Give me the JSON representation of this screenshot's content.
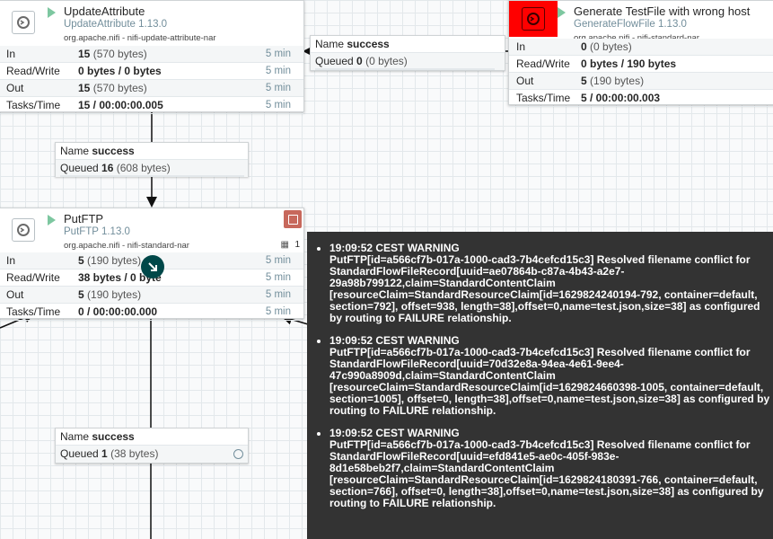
{
  "processors": {
    "update": {
      "name": "UpdateAttribute",
      "type": "UpdateAttribute 1.13.0",
      "bundle": "org.apache.nifi - nifi-update-attribute-nar",
      "stats": [
        {
          "label": "In",
          "value": "15",
          "detail": "(570 bytes)",
          "time": "5 min"
        },
        {
          "label": "Read/Write",
          "value": "0 bytes / 0 bytes",
          "detail": "",
          "time": "5 min"
        },
        {
          "label": "Out",
          "value": "15",
          "detail": "(570 bytes)",
          "time": "5 min"
        },
        {
          "label": "Tasks/Time",
          "value": "15 / 00:00:00.005",
          "detail": "",
          "time": "5 min"
        }
      ]
    },
    "generate": {
      "name": "Generate TestFile with wrong host",
      "type": "GenerateFlowFile 1.13.0",
      "bundle": "org.apache.nifi - nifi-standard-nar",
      "stats": [
        {
          "label": "In",
          "value": "0",
          "detail": "(0 bytes)",
          "time": ""
        },
        {
          "label": "Read/Write",
          "value": "0 bytes / 190 bytes",
          "detail": "",
          "time": ""
        },
        {
          "label": "Out",
          "value": "5",
          "detail": "(190 bytes)",
          "time": ""
        },
        {
          "label": "Tasks/Time",
          "value": "5 / 00:00:00.003",
          "detail": "",
          "time": ""
        }
      ]
    },
    "putftp": {
      "name": "PutFTP",
      "type": "PutFTP 1.13.0",
      "bundle": "org.apache.nifi - nifi-standard-nar",
      "task_count": "1",
      "stats": [
        {
          "label": "In",
          "value": "5",
          "detail": "(190 bytes)",
          "time": "5 min"
        },
        {
          "label": "Read/Write",
          "value": "38 bytes / 0 byte",
          "detail": "",
          "time": "5 min"
        },
        {
          "label": "Out",
          "value": "5",
          "detail": "(190 bytes)",
          "time": "5 min"
        },
        {
          "label": "Tasks/Time",
          "value": "0 / 00:00:00.000",
          "detail": "",
          "time": "5 min"
        }
      ]
    }
  },
  "connections": {
    "top": {
      "name_label": "Name",
      "name": "success",
      "queued_label": "Queued",
      "count": "0",
      "size": "(0 bytes)"
    },
    "middle": {
      "name_label": "Name",
      "name": "success",
      "queued_label": "Queued",
      "count": "16",
      "size": "(608 bytes)"
    },
    "bottom": {
      "name_label": "Name",
      "name": "success",
      "queued_label": "Queued",
      "count": "1",
      "size": "(38 bytes)"
    }
  },
  "bulletins": [
    "19:09:52 CEST   WARNING\nPutFTP[id=a566cf7b-017a-1000-cad3-7b4cefcd15c3] Resolved filename conflict for StandardFlowFileRecord[uuid=ae07864b-c87a-4b43-a2e7-29a98b799122,claim=StandardContentClaim [resourceClaim=StandardResourceClaim[id=1629824240194-792, container=default, section=792], offset=938, length=38],offset=0,name=test.json,size=38] as configured by routing to FAILURE relationship.",
    "19:09:52 CEST   WARNING\nPutFTP[id=a566cf7b-017a-1000-cad3-7b4cefcd15c3] Resolved filename conflict for StandardFlowFileRecord[uuid=70d32e8a-94ea-4e61-9ee4-47c990a8909d,claim=StandardContentClaim [resourceClaim=StandardResourceClaim[id=1629824660398-1005, container=default, section=1005], offset=0, length=38],offset=0,name=test.json,size=38] as configured by routing to FAILURE relationship.",
    "19:09:52 CEST   WARNING\nPutFTP[id=a566cf7b-017a-1000-cad3-7b4cefcd15c3] Resolved filename conflict for StandardFlowFileRecord[uuid=efd841e5-ae0c-405f-983e-8d1e58beb2f7,claim=StandardContentClaim [resourceClaim=StandardResourceClaim[id=1629824180391-766, container=default, section=766], offset=0, length=38],offset=0,name=test.json,size=38] as configured by routing to FAILURE relationship."
  ],
  "colors": {
    "error_bg": "#ff0000",
    "accent": "#004849",
    "run_icon": "#7dc7a0",
    "bulletin_bg": "#333333"
  }
}
